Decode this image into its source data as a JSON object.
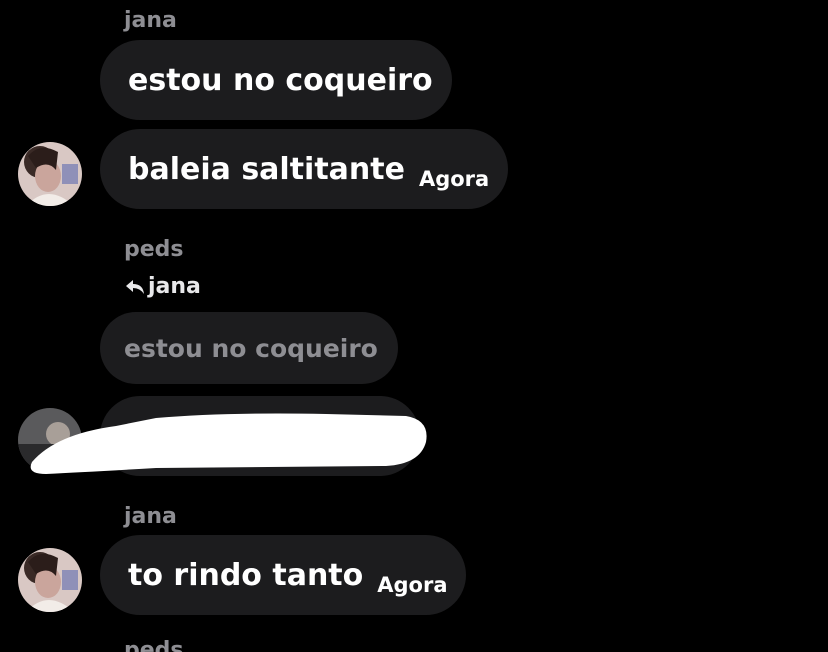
{
  "messages": [
    {
      "sender": "jana",
      "text": "estou no coqueiro"
    },
    {
      "text": "baleia saltitante",
      "time": "Agora"
    },
    {
      "sender": "peds",
      "reply_to": "jana",
      "quoted_text": "estou no coqueiro"
    },
    {
      "sender": "jana",
      "text": "to rindo tanto",
      "time": "Agora"
    },
    {
      "sender": "peds"
    }
  ],
  "colors": {
    "background": "#000000",
    "bubble": "#1c1c1e",
    "sender_name": "#8e8e93",
    "message_text": "#ffffff"
  },
  "icons": {
    "reply": "reply-arrow-icon"
  }
}
